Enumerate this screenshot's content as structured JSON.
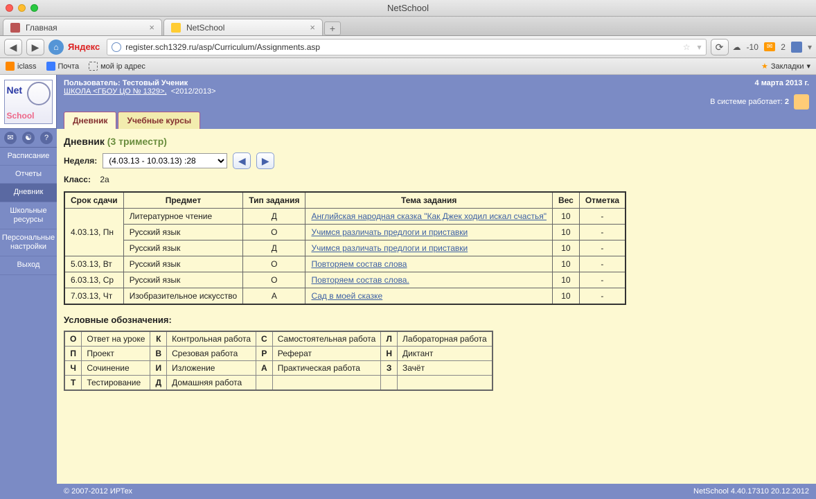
{
  "window_title": "NetSchool",
  "browser_tabs": [
    {
      "label": "Главная"
    },
    {
      "label": "NetSchool"
    }
  ],
  "url": "register.sch1329.ru/asp/Curriculum/Assignments.asp",
  "search_engine": "Яндекс",
  "weather_temp": "-10",
  "mail_count": "2",
  "bookmarks": [
    "iclass",
    "Почта",
    "мой ip адрес"
  ],
  "bookmark_button": "Закладки",
  "user_line_label": "Пользователь:",
  "user_name": "Тестовый Ученик",
  "school_link": "ШКОЛА <ГБОУ ЦО № 1329>,",
  "year": "<2012/2013>",
  "date_text": "4 марта 2013 г.",
  "online_label": "В системе работает:",
  "online_count": "2",
  "page_tabs": [
    "Дневник",
    "Учебные курсы"
  ],
  "side_links": [
    "Расписание",
    "Отчеты",
    "Дневник",
    "Школьные ресурсы",
    "Персональные настройки",
    "Выход"
  ],
  "diary_title": "Дневник",
  "trimester": "(3 триместр)",
  "week_label": "Неделя:",
  "week_value": "(4.03.13 - 10.03.13) :28",
  "class_label": "Класс:",
  "class_value": "2а",
  "columns": {
    "due": "Срок сдачи",
    "subject": "Предмет",
    "type": "Тип задания",
    "topic": "Тема задания",
    "weight": "Вес",
    "mark": "Отметка"
  },
  "rows": [
    {
      "due": "4.03.13, Пн",
      "subject": "Литературное чтение",
      "type": "Д",
      "topic": "Английская народная сказка \"Как Джек ходил искал счастья\"",
      "weight": "10",
      "mark": "-"
    },
    {
      "due": "",
      "subject": "Русский язык",
      "type": "О",
      "topic": "Учимся различать предлоги и приставки",
      "weight": "10",
      "mark": "-"
    },
    {
      "due": "",
      "subject": "Русский язык",
      "type": "Д",
      "topic": "Учимся различать предлоги и приставки",
      "weight": "10",
      "mark": "-"
    },
    {
      "due": "5.03.13, Вт",
      "subject": "Русский язык",
      "type": "О",
      "topic": "Повторяем состав слова",
      "weight": "10",
      "mark": "-"
    },
    {
      "due": "6.03.13, Ср",
      "subject": "Русский язык",
      "type": "О",
      "topic": "Повторяем состав слова.",
      "weight": "10",
      "mark": "-"
    },
    {
      "due": "7.03.13, Чт",
      "subject": "Изобразительное искусство",
      "type": "А",
      "topic": "Сад в моей сказке",
      "weight": "10",
      "mark": "-"
    }
  ],
  "legend_title": "Условные обозначения:",
  "legend": [
    [
      "О",
      "Ответ на уроке",
      "К",
      "Контрольная работа",
      "С",
      "Самостоятельная работа",
      "Л",
      "Лабораторная работа"
    ],
    [
      "П",
      "Проект",
      "В",
      "Срезовая работа",
      "Р",
      "Реферат",
      "Н",
      "Диктант"
    ],
    [
      "Ч",
      "Сочинение",
      "И",
      "Изложение",
      "А",
      "Практическая работа",
      "З",
      "Зачёт"
    ],
    [
      "Т",
      "Тестирование",
      "Д",
      "Домашняя работа",
      "",
      "",
      "",
      ""
    ]
  ],
  "footer_left": "© 2007-2012 ИРТех",
  "footer_right": "NetSchool 4.40.17310   20.12.2012"
}
